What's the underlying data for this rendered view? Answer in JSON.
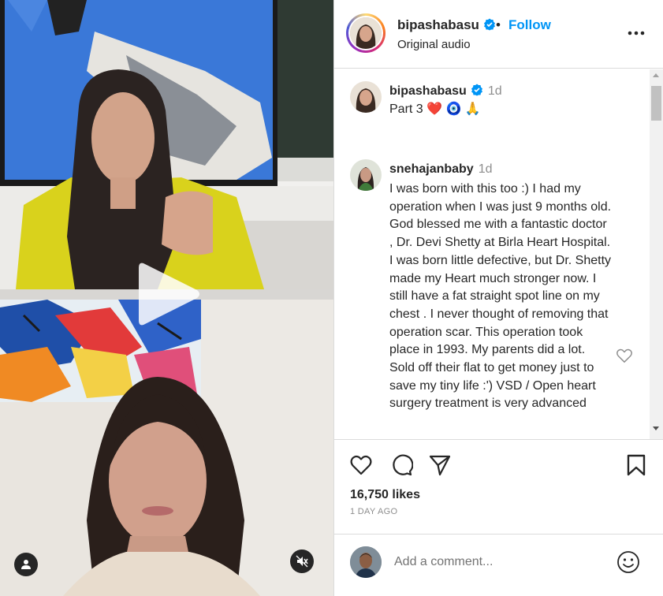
{
  "post": {
    "username": "bipashabasu",
    "separator": "•",
    "follow_label": "Follow",
    "audio": "Original audio"
  },
  "caption": {
    "username": "bipashabasu",
    "time": "1d",
    "text": "Part 3 ❤️ 🧿 🙏"
  },
  "comments": [
    {
      "username": "snehajanbaby",
      "time": "1d",
      "text": "I was born with this too :) I had my operation when I was just 9 months old. God blessed me with a fantastic doctor , Dr. Devi Shetty at Birla Heart Hospital. I was born little defective, but Dr. Shetty made my Heart much stronger now. I still have a fat straight spot line on my chest . I never thought of removing that operation scar. This operation took place in 1993. My parents did a lot. Sold off their flat to get money just to save my tiny life :') VSD / Open heart surgery treatment is very advanced"
    }
  ],
  "stats": {
    "likes": "16,750 likes",
    "posted": "1 DAY AGO"
  },
  "composer": {
    "placeholder": "Add a comment..."
  },
  "colors": {
    "link_blue": "#0095f6",
    "verified_blue": "#0095f6",
    "text": "#262626",
    "muted": "#8e8e8e"
  },
  "icons": [
    "verified-icon",
    "more-options-icon",
    "like-icon",
    "comment-icon",
    "share-icon",
    "save-icon",
    "emoji-icon",
    "play-icon",
    "user-tag-icon",
    "mute-icon"
  ]
}
